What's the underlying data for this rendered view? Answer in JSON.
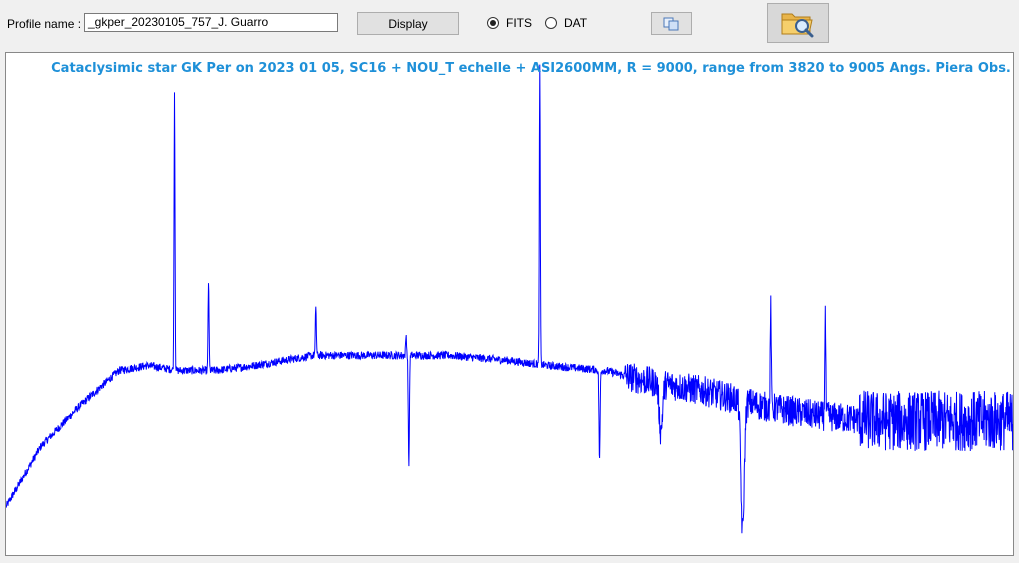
{
  "toolbar": {
    "profile_label": "Profile name :",
    "profile_value": "_gkper_20230105_757_J. Guarro",
    "display_label": "Display",
    "format_options": [
      {
        "label": "FITS",
        "selected": true
      },
      {
        "label": "DAT",
        "selected": false
      }
    ],
    "copy_icon": "copy-icon",
    "open_icon": "folder-search-icon"
  },
  "plot": {
    "title": "Cataclysimic star GK Per on 2023 01 05, SC16 + NOU_T echelle + ASI2600MM, R = 9000, range from 3820 to 9005 Angs. Piera Obs.",
    "line_color": "#0000ff",
    "title_color": "#1e90d8"
  },
  "chart_data": {
    "type": "line",
    "x_range": [
      3820,
      9005
    ],
    "x_unit": "Angs.",
    "ylim": [
      0,
      1.0
    ],
    "grid": false,
    "series": [
      {
        "continuum": [
          [
            3820,
            0.1
          ],
          [
            4000,
            0.22
          ],
          [
            4200,
            0.3
          ],
          [
            4400,
            0.37
          ],
          [
            4550,
            0.38
          ],
          [
            4700,
            0.37
          ],
          [
            4900,
            0.37
          ],
          [
            5100,
            0.38
          ],
          [
            5400,
            0.4
          ],
          [
            5700,
            0.4
          ],
          [
            5900,
            0.4
          ],
          [
            6100,
            0.4
          ],
          [
            6400,
            0.39
          ],
          [
            6600,
            0.38
          ],
          [
            6900,
            0.37
          ],
          [
            7100,
            0.35
          ],
          [
            7400,
            0.33
          ],
          [
            7700,
            0.3
          ],
          [
            8000,
            0.28
          ],
          [
            8300,
            0.27
          ],
          [
            8600,
            0.27
          ],
          [
            9005,
            0.27
          ]
        ],
        "emission_lines": [
          {
            "x": 4686,
            "peak": 0.93
          },
          {
            "x": 4861,
            "peak": 0.55
          },
          {
            "x": 5412,
            "peak": 0.5
          },
          {
            "x": 5876,
            "peak": 0.44
          },
          {
            "x": 6563,
            "peak": 0.97
          },
          {
            "x": 7750,
            "peak": 0.5
          },
          {
            "x": 8030,
            "peak": 0.49
          }
        ],
        "absorption_features": [
          {
            "x": 5890,
            "depth": 0.18
          },
          {
            "x": 6870,
            "depth": 0.19
          },
          {
            "x": 7185,
            "depth": 0.25
          },
          {
            "x": 7605,
            "depth": 0.05
          }
        ]
      }
    ]
  }
}
